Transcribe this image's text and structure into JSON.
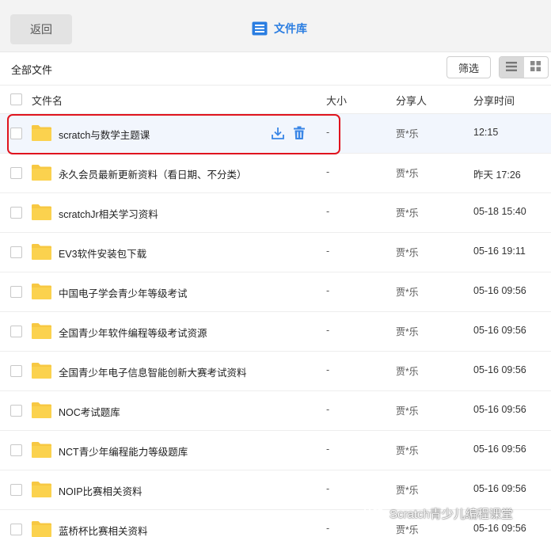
{
  "header": {
    "back_label": "返回",
    "title": "文件库",
    "title_icon": "document-list-icon",
    "accent_color": "#2a7de1"
  },
  "toolbar": {
    "breadcrumb": "全部文件",
    "filter_label": "筛选",
    "view_modes": [
      "list-view-icon",
      "grid-view-icon"
    ],
    "active_view": "list"
  },
  "table": {
    "columns": [
      "文件名",
      "大小",
      "分享人",
      "分享时间"
    ],
    "rows": [
      {
        "name": "scratch与数学主题课",
        "size": "-",
        "sharer": "贾*乐",
        "time": "12:15",
        "selected": true
      },
      {
        "name": "永久会员最新更新资料（看日期、不分类）",
        "size": "-",
        "sharer": "贾*乐",
        "time": "昨天 17:26"
      },
      {
        "name": "scratchJr相关学习资料",
        "size": "-",
        "sharer": "贾*乐",
        "time": "05-18 15:40"
      },
      {
        "name": "EV3软件安装包下载",
        "size": "-",
        "sharer": "贾*乐",
        "time": "05-16 19:11"
      },
      {
        "name": "中国电子学会青少年等级考试",
        "size": "-",
        "sharer": "贾*乐",
        "time": "05-16 09:56"
      },
      {
        "name": "全国青少年软件编程等级考试资源",
        "size": "-",
        "sharer": "贾*乐",
        "time": "05-16 09:56"
      },
      {
        "name": "全国青少年电子信息智能创新大赛考试资料",
        "size": "-",
        "sharer": "贾*乐",
        "time": "05-16 09:56"
      },
      {
        "name": "NOC考试题库",
        "size": "-",
        "sharer": "贾*乐",
        "time": "05-16 09:56"
      },
      {
        "name": "NCT青少年编程能力等级题库",
        "size": "-",
        "sharer": "贾*乐",
        "time": "05-16 09:56"
      },
      {
        "name": "NOIP比赛相关资料",
        "size": "-",
        "sharer": "贾*乐",
        "time": "05-16 09:56"
      },
      {
        "name": "蓝桥杯比赛相关资料",
        "size": "-",
        "sharer": "贾*乐",
        "time": "05-16 09:56"
      }
    ],
    "row_actions": [
      "download-icon",
      "delete-icon"
    ],
    "folder_color": "#f7c843",
    "highlight_color": "#e0141e"
  },
  "watermark": {
    "text": "Scratch青少儿编程课堂",
    "icon": "wechat-icon"
  }
}
